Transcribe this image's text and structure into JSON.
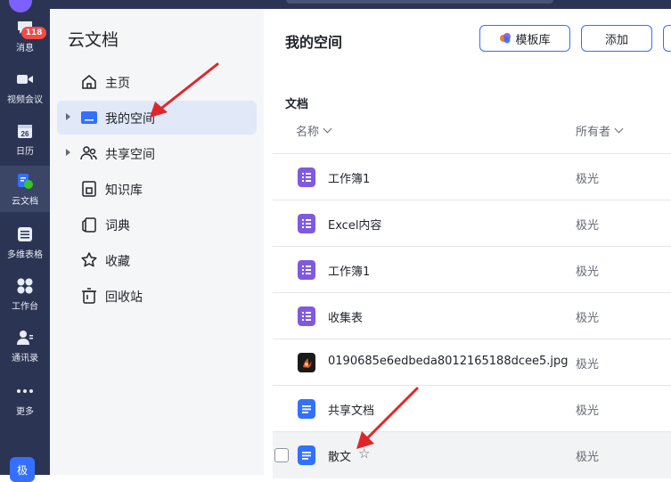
{
  "rail": {
    "badge": "118",
    "items": [
      {
        "label": "消息",
        "icon": "chat-bubble-icon"
      },
      {
        "label": "视频会议",
        "icon": "video-camera-icon"
      },
      {
        "label": "日历",
        "icon": "calendar-icon",
        "day": "26"
      },
      {
        "label": "云文档",
        "icon": "cloud-doc-icon"
      },
      {
        "label": "多维表格",
        "icon": "base-table-icon"
      },
      {
        "label": "工作台",
        "icon": "workspace-grid-icon"
      },
      {
        "label": "通讯录",
        "icon": "contacts-icon"
      },
      {
        "label": "更多",
        "icon": "more-dots-icon"
      }
    ],
    "bottom_avatar": "极"
  },
  "sidebar": {
    "title": "云文档",
    "items": [
      {
        "label": "主页",
        "icon": "home-icon"
      },
      {
        "label": "我的空间",
        "icon": "folder-icon"
      },
      {
        "label": "共享空间",
        "icon": "shared-people-icon"
      },
      {
        "label": "知识库",
        "icon": "knowledge-base-icon"
      },
      {
        "label": "词典",
        "icon": "dictionary-icon"
      },
      {
        "label": "收藏",
        "icon": "star-icon"
      },
      {
        "label": "回收站",
        "icon": "trash-icon"
      }
    ]
  },
  "main": {
    "title": "我的空间",
    "buttons": {
      "template": "模板库",
      "add": "添加"
    },
    "section": "文档",
    "columns": {
      "name": "名称",
      "owner": "所有者"
    },
    "files": [
      {
        "name": "工作簿1",
        "owner": "极光",
        "type": "sheet"
      },
      {
        "name": "Excel内容",
        "owner": "极光",
        "type": "sheet"
      },
      {
        "name": "工作簿1",
        "owner": "极光",
        "type": "sheet"
      },
      {
        "name": "收集表",
        "owner": "极光",
        "type": "sheet"
      },
      {
        "name": "0190685e6edbeda8012165188dcee5.jpg",
        "owner": "极光",
        "type": "image"
      },
      {
        "name": "共享文档",
        "owner": "极光",
        "type": "doc"
      },
      {
        "name": "散文",
        "owner": "极光",
        "type": "doc"
      }
    ]
  },
  "colors": {
    "accent": "#3370ff",
    "rail": "#2b3553",
    "sheet": "#7f5ae0",
    "arrow": "#e0262b"
  }
}
